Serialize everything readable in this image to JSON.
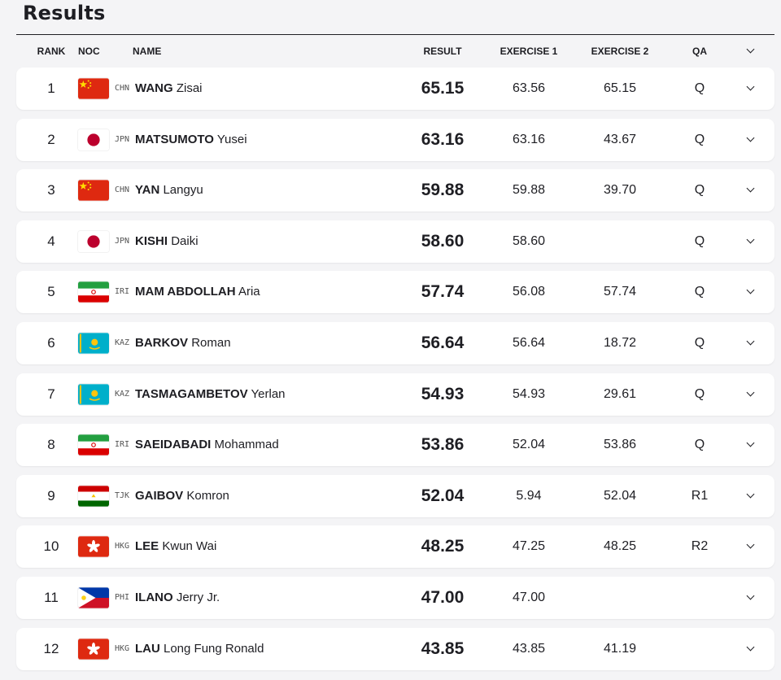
{
  "page": {
    "title": "Results"
  },
  "table": {
    "headers": {
      "rank": "RANK",
      "noc": "NOC",
      "name": "NAME",
      "result": "RESULT",
      "exercise1": "EXERCISE 1",
      "exercise2": "EXERCISE 2",
      "qa": "QA"
    },
    "rows": [
      {
        "rank": "1",
        "noc": "CHN",
        "flag": "china-flag-icon",
        "surname": "WANG",
        "given": "Zisai",
        "result": "65.15",
        "ex1": "63.56",
        "ex2": "65.15",
        "qa": "Q"
      },
      {
        "rank": "2",
        "noc": "JPN",
        "flag": "japan-flag-icon",
        "surname": "MATSUMOTO",
        "given": "Yusei",
        "result": "63.16",
        "ex1": "63.16",
        "ex2": "43.67",
        "qa": "Q"
      },
      {
        "rank": "3",
        "noc": "CHN",
        "flag": "china-flag-icon",
        "surname": "YAN",
        "given": "Langyu",
        "result": "59.88",
        "ex1": "59.88",
        "ex2": "39.70",
        "qa": "Q"
      },
      {
        "rank": "4",
        "noc": "JPN",
        "flag": "japan-flag-icon",
        "surname": "KISHI",
        "given": "Daiki",
        "result": "58.60",
        "ex1": "58.60",
        "ex2": "",
        "qa": "Q"
      },
      {
        "rank": "5",
        "noc": "IRI",
        "flag": "iran-flag-icon",
        "surname": "MAM ABDOLLAH",
        "given": "Aria",
        "result": "57.74",
        "ex1": "56.08",
        "ex2": "57.74",
        "qa": "Q"
      },
      {
        "rank": "6",
        "noc": "KAZ",
        "flag": "kazakhstan-flag-icon",
        "surname": "BARKOV",
        "given": "Roman",
        "result": "56.64",
        "ex1": "56.64",
        "ex2": "18.72",
        "qa": "Q"
      },
      {
        "rank": "7",
        "noc": "KAZ",
        "flag": "kazakhstan-flag-icon",
        "surname": "TASMAGAMBETOV",
        "given": "Yerlan",
        "result": "54.93",
        "ex1": "54.93",
        "ex2": "29.61",
        "qa": "Q"
      },
      {
        "rank": "8",
        "noc": "IRI",
        "flag": "iran-flag-icon",
        "surname": "SAEIDABADI",
        "given": "Mohammad",
        "result": "53.86",
        "ex1": "52.04",
        "ex2": "53.86",
        "qa": "Q"
      },
      {
        "rank": "9",
        "noc": "TJK",
        "flag": "tajikistan-flag-icon",
        "surname": "GAIBOV",
        "given": "Komron",
        "result": "52.04",
        "ex1": "5.94",
        "ex2": "52.04",
        "qa": "R1"
      },
      {
        "rank": "10",
        "noc": "HKG",
        "flag": "hong-kong-flag-icon",
        "surname": "LEE",
        "given": "Kwun Wai",
        "result": "48.25",
        "ex1": "47.25",
        "ex2": "48.25",
        "qa": "R2"
      },
      {
        "rank": "11",
        "noc": "PHI",
        "flag": "philippines-flag-icon",
        "surname": "ILANO",
        "given": "Jerry Jr.",
        "result": "47.00",
        "ex1": "47.00",
        "ex2": "",
        "qa": ""
      },
      {
        "rank": "12",
        "noc": "HKG",
        "flag": "hong-kong-flag-icon",
        "surname": "LAU",
        "given": "Long Fung Ronald",
        "result": "43.85",
        "ex1": "43.85",
        "ex2": "41.19",
        "qa": ""
      }
    ]
  },
  "colors": {
    "text": "#1e1e23",
    "background": "#f4f4f6",
    "row": "#ffffff"
  }
}
